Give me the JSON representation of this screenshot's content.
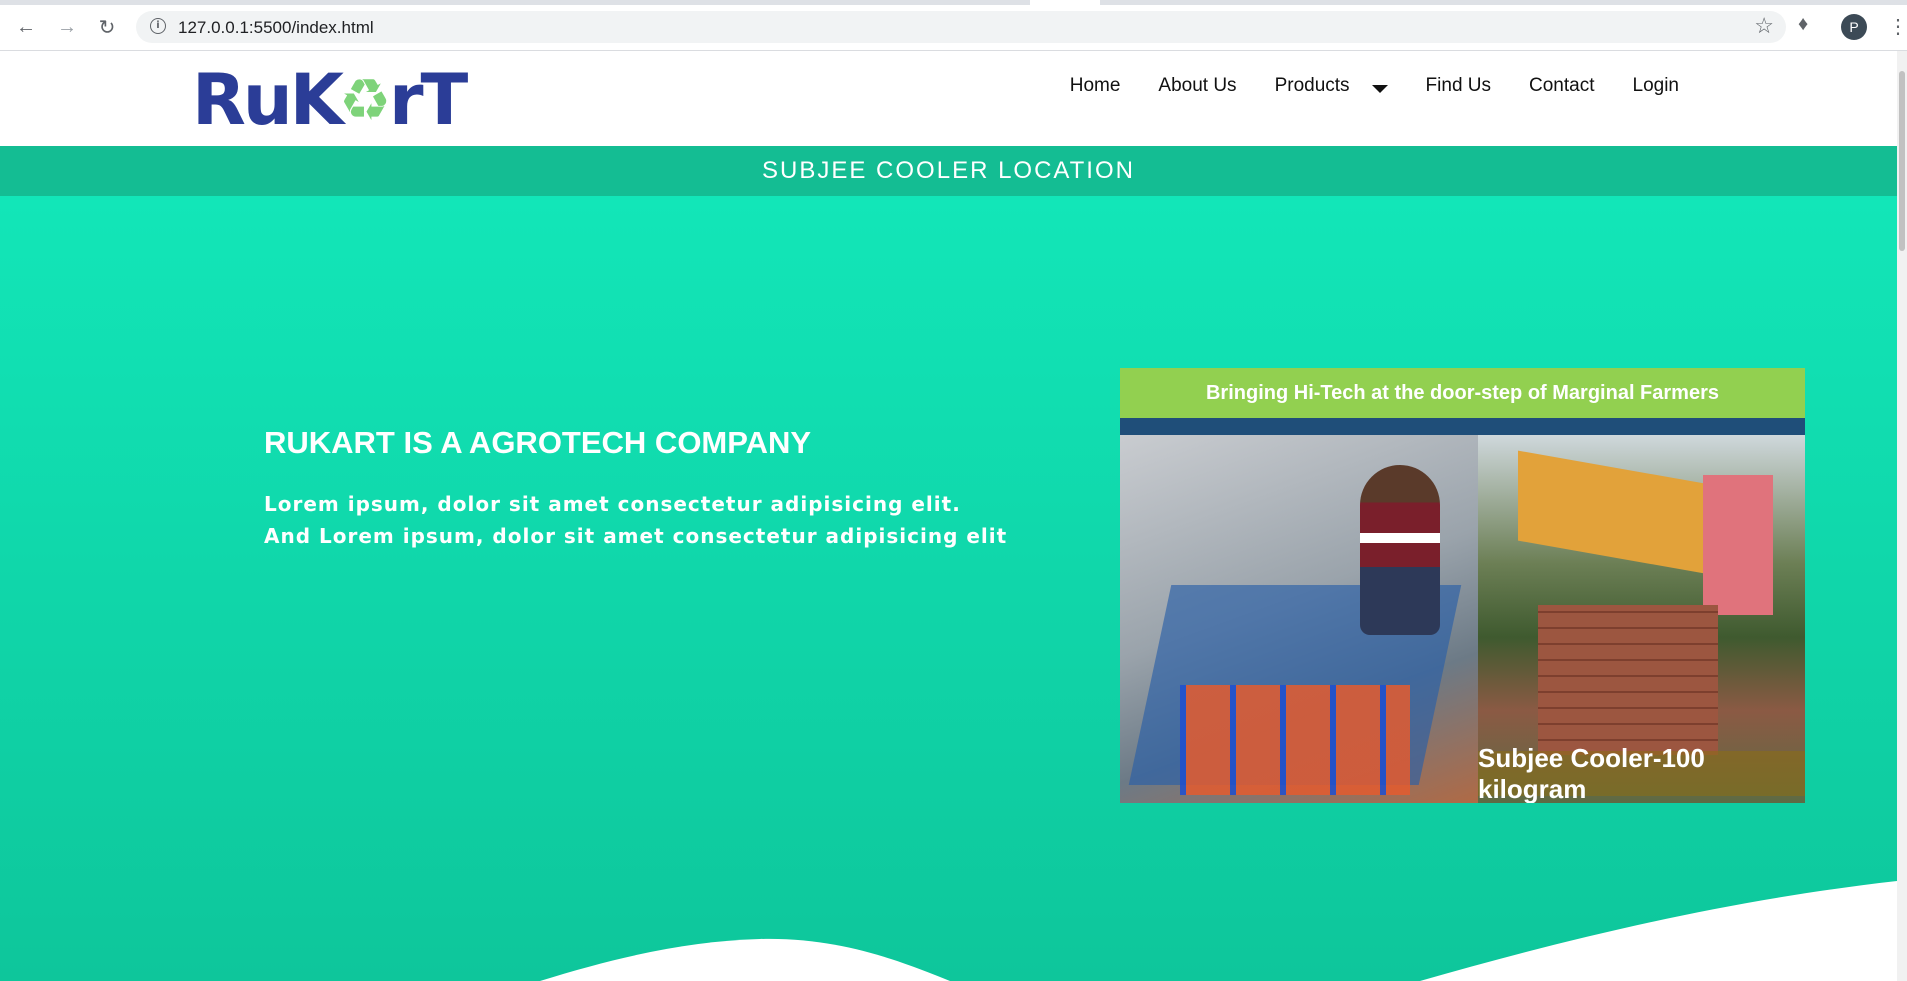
{
  "browser": {
    "url": "127.0.0.1:5500/index.html",
    "profile_initial": "P"
  },
  "header": {
    "logo_text": {
      "part1": "RuK",
      "part2": "rT"
    },
    "nav": {
      "home": "Home",
      "about": "About Us",
      "products": "Products",
      "find_us": "Find Us",
      "contact": "Contact",
      "login": "Login"
    }
  },
  "banner": {
    "title": "SUBJEE COOLER LOCATION"
  },
  "hero": {
    "heading": "RUKART IS A AGROTECH COMPANY",
    "line1": "Lorem ipsum, dolor sit amet consectetur adipisicing elit.",
    "line2": "And Lorem ipsum, dolor sit amet consectetur adipisicing elit",
    "image": {
      "top_text": "Bringing  Hi-Tech at the door-step of Marginal Farmers",
      "caption": "Subjee Cooler-100 kilogram"
    }
  },
  "colors": {
    "banner": "#14bd93",
    "hero_top": "#12e6b8",
    "hero_bottom": "#0ec69b",
    "logo_blue": "#2b3d97",
    "logo_green": "#7ed37a"
  }
}
